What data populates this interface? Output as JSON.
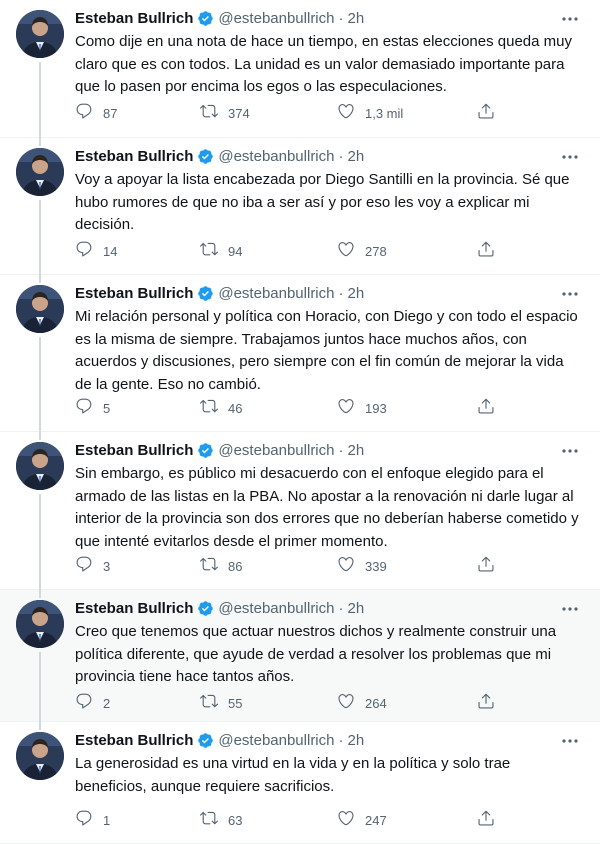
{
  "colors": {
    "text": "#0f1419",
    "muted": "#536471",
    "verified": "#1d9bf0",
    "divider": "#eff3f4",
    "hover_bg": "#f7f9f9"
  },
  "tweets": [
    {
      "name": "Esteban Bullrich",
      "handle": "@estebanbullrich",
      "dot": "·",
      "time": "2h",
      "text": "Como dije en una nota de hace un tiempo, en estas elecciones queda muy claro que es con todos. La unidad es un valor demasiado importante para que lo pasen por encima los egos o las especulaciones.",
      "replies": "87",
      "retweets": "374",
      "likes": "1,3 mil"
    },
    {
      "name": "Esteban Bullrich",
      "handle": "@estebanbullrich",
      "dot": "·",
      "time": "2h",
      "text": "Voy a apoyar la lista encabezada por Diego Santilli en la provincia. Sé que hubo rumores de que no iba a ser así y por eso les voy a explicar mi decisión.",
      "replies": "14",
      "retweets": "94",
      "likes": "278"
    },
    {
      "name": "Esteban Bullrich",
      "handle": "@estebanbullrich",
      "dot": "·",
      "time": "2h",
      "text": "Mi relación personal y política con Horacio, con Diego y con todo el espacio es la misma de siempre. Trabajamos juntos hace muchos años, con acuerdos y discusiones, pero siempre con el fin común de mejorar la vida de la gente. Eso no cambió.",
      "replies": "5",
      "retweets": "46",
      "likes": "193"
    },
    {
      "name": "Esteban Bullrich",
      "handle": "@estebanbullrich",
      "dot": "·",
      "time": "2h",
      "text": "Sin embargo, es público mi desacuerdo con el enfoque elegido para el armado de las listas en la PBA. No apostar a la renovación ni darle lugar al interior de la provincia son dos errores que no deberían haberse cometido y que intenté evitarlos desde el primer momento.",
      "replies": "3",
      "retweets": "86",
      "likes": "339"
    },
    {
      "name": "Esteban Bullrich",
      "handle": "@estebanbullrich",
      "dot": "·",
      "time": "2h",
      "text": "Creo que tenemos que actuar nuestros dichos y realmente construir una política diferente, que ayude de verdad a resolver los problemas que mi provincia tiene hace tantos años.",
      "replies": "2",
      "retweets": "55",
      "likes": "264"
    },
    {
      "name": "Esteban Bullrich",
      "handle": "@estebanbullrich",
      "dot": "·",
      "time": "2h",
      "text": "La generosidad es una virtud en la vida y en la política y solo trae beneficios, aunque requiere sacrificios.",
      "replies": "1",
      "retweets": "63",
      "likes": "247"
    }
  ]
}
